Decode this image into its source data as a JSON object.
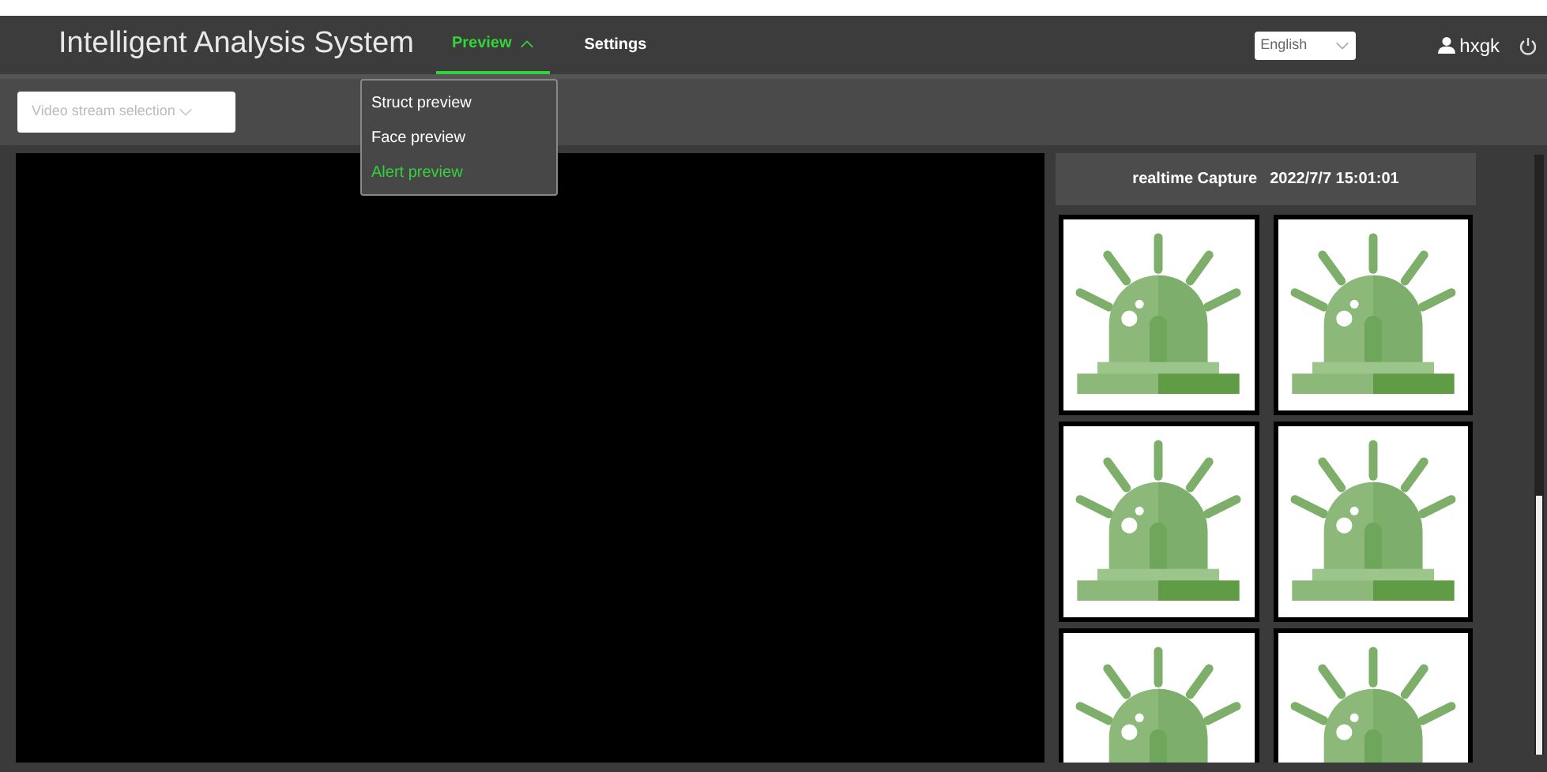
{
  "header": {
    "title": "Intelligent Analysis System",
    "nav": [
      {
        "label": "Preview",
        "selected": true,
        "expanded": true
      },
      {
        "label": "Settings",
        "selected": false,
        "expanded": false
      }
    ],
    "language": {
      "value": "English"
    },
    "user": {
      "name": "hxgk"
    }
  },
  "nav_menu": [
    {
      "label": "Struct preview",
      "selected": false
    },
    {
      "label": "Face preview",
      "selected": false
    },
    {
      "label": "Alert preview",
      "selected": true
    }
  ],
  "toolbar": {
    "stream_select": {
      "placeholder": "Video stream selection"
    }
  },
  "capture_panel": {
    "title": "realtime Capture",
    "time": "2022/7/7 15:01:01",
    "captures": [
      {
        "kind": "siren"
      },
      {
        "kind": "siren"
      },
      {
        "kind": "siren"
      },
      {
        "kind": "siren"
      },
      {
        "kind": "siren"
      },
      {
        "kind": "siren"
      }
    ]
  }
}
